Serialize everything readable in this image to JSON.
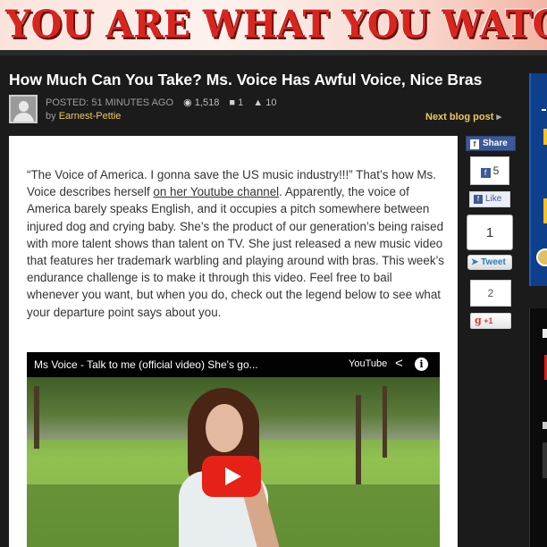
{
  "banner": {
    "text": "YOU ARE WHAT YOU WATCH"
  },
  "post": {
    "title": "How Much Can You Take? Ms. Voice Has Awful Voice, Nice Bras",
    "posted": "POSTED: 51 MINUTES AGO",
    "views": "1,518",
    "comments": "1",
    "likes": "10",
    "by_prefix": "by",
    "author": "Earnest-Pettie",
    "next_label": "Next blog post"
  },
  "article": {
    "text_before_link": "“The Voice of America. I gonna save the US music industry!!!” That’s how Ms. Voice describes herself ",
    "link_text": "on her Youtube channel",
    "text_after_link": ". Apparently, the voice of America barely speaks English, and it occupies a pitch somewhere between injured dog and crying baby. She’s the product of our generation’s being raised with more talent shows than talent on TV. She just released a new music video that features her trademark warbling and playing around with bras. This week’s endurance challenge is to make it through this video. Feel free to bail whenever you want, but when you do, check out the legend below to see what your departure point says about you."
  },
  "video": {
    "title": "Ms Voice - Talk to me (official video) She's go...",
    "source": "YouTube",
    "share_glyph": "<",
    "info_glyph": "i"
  },
  "social": {
    "fb_share_label": "Share",
    "fb_count": "5",
    "fb_like_label": "Like",
    "tweet_count": "1",
    "tweet_label": "Tweet",
    "gplus_count": "2",
    "gplus_label": "+1"
  },
  "colors": {
    "banner_text": "#d8261f",
    "accent_link": "#f0c860",
    "facebook": "#3b5998",
    "youtube_red": "#e62117"
  },
  "icons": [
    "eye-icon",
    "comment-icon",
    "thumbs-up-icon",
    "share-icon",
    "info-icon",
    "play-icon",
    "facebook-icon",
    "twitter-icon",
    "google-plus-icon"
  ]
}
